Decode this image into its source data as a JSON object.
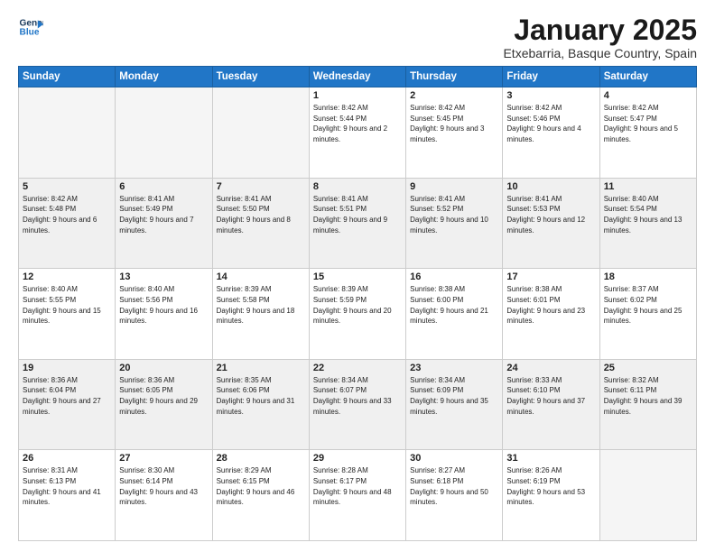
{
  "logo": {
    "line1": "General",
    "line2": "Blue"
  },
  "title": "January 2025",
  "subtitle": "Etxebarria, Basque Country, Spain",
  "headers": [
    "Sunday",
    "Monday",
    "Tuesday",
    "Wednesday",
    "Thursday",
    "Friday",
    "Saturday"
  ],
  "weeks": [
    [
      {
        "day": "",
        "sunrise": "",
        "sunset": "",
        "daylight": ""
      },
      {
        "day": "",
        "sunrise": "",
        "sunset": "",
        "daylight": ""
      },
      {
        "day": "",
        "sunrise": "",
        "sunset": "",
        "daylight": ""
      },
      {
        "day": "1",
        "sunrise": "Sunrise: 8:42 AM",
        "sunset": "Sunset: 5:44 PM",
        "daylight": "Daylight: 9 hours and 2 minutes."
      },
      {
        "day": "2",
        "sunrise": "Sunrise: 8:42 AM",
        "sunset": "Sunset: 5:45 PM",
        "daylight": "Daylight: 9 hours and 3 minutes."
      },
      {
        "day": "3",
        "sunrise": "Sunrise: 8:42 AM",
        "sunset": "Sunset: 5:46 PM",
        "daylight": "Daylight: 9 hours and 4 minutes."
      },
      {
        "day": "4",
        "sunrise": "Sunrise: 8:42 AM",
        "sunset": "Sunset: 5:47 PM",
        "daylight": "Daylight: 9 hours and 5 minutes."
      }
    ],
    [
      {
        "day": "5",
        "sunrise": "Sunrise: 8:42 AM",
        "sunset": "Sunset: 5:48 PM",
        "daylight": "Daylight: 9 hours and 6 minutes."
      },
      {
        "day": "6",
        "sunrise": "Sunrise: 8:41 AM",
        "sunset": "Sunset: 5:49 PM",
        "daylight": "Daylight: 9 hours and 7 minutes."
      },
      {
        "day": "7",
        "sunrise": "Sunrise: 8:41 AM",
        "sunset": "Sunset: 5:50 PM",
        "daylight": "Daylight: 9 hours and 8 minutes."
      },
      {
        "day": "8",
        "sunrise": "Sunrise: 8:41 AM",
        "sunset": "Sunset: 5:51 PM",
        "daylight": "Daylight: 9 hours and 9 minutes."
      },
      {
        "day": "9",
        "sunrise": "Sunrise: 8:41 AM",
        "sunset": "Sunset: 5:52 PM",
        "daylight": "Daylight: 9 hours and 10 minutes."
      },
      {
        "day": "10",
        "sunrise": "Sunrise: 8:41 AM",
        "sunset": "Sunset: 5:53 PM",
        "daylight": "Daylight: 9 hours and 12 minutes."
      },
      {
        "day": "11",
        "sunrise": "Sunrise: 8:40 AM",
        "sunset": "Sunset: 5:54 PM",
        "daylight": "Daylight: 9 hours and 13 minutes."
      }
    ],
    [
      {
        "day": "12",
        "sunrise": "Sunrise: 8:40 AM",
        "sunset": "Sunset: 5:55 PM",
        "daylight": "Daylight: 9 hours and 15 minutes."
      },
      {
        "day": "13",
        "sunrise": "Sunrise: 8:40 AM",
        "sunset": "Sunset: 5:56 PM",
        "daylight": "Daylight: 9 hours and 16 minutes."
      },
      {
        "day": "14",
        "sunrise": "Sunrise: 8:39 AM",
        "sunset": "Sunset: 5:58 PM",
        "daylight": "Daylight: 9 hours and 18 minutes."
      },
      {
        "day": "15",
        "sunrise": "Sunrise: 8:39 AM",
        "sunset": "Sunset: 5:59 PM",
        "daylight": "Daylight: 9 hours and 20 minutes."
      },
      {
        "day": "16",
        "sunrise": "Sunrise: 8:38 AM",
        "sunset": "Sunset: 6:00 PM",
        "daylight": "Daylight: 9 hours and 21 minutes."
      },
      {
        "day": "17",
        "sunrise": "Sunrise: 8:38 AM",
        "sunset": "Sunset: 6:01 PM",
        "daylight": "Daylight: 9 hours and 23 minutes."
      },
      {
        "day": "18",
        "sunrise": "Sunrise: 8:37 AM",
        "sunset": "Sunset: 6:02 PM",
        "daylight": "Daylight: 9 hours and 25 minutes."
      }
    ],
    [
      {
        "day": "19",
        "sunrise": "Sunrise: 8:36 AM",
        "sunset": "Sunset: 6:04 PM",
        "daylight": "Daylight: 9 hours and 27 minutes."
      },
      {
        "day": "20",
        "sunrise": "Sunrise: 8:36 AM",
        "sunset": "Sunset: 6:05 PM",
        "daylight": "Daylight: 9 hours and 29 minutes."
      },
      {
        "day": "21",
        "sunrise": "Sunrise: 8:35 AM",
        "sunset": "Sunset: 6:06 PM",
        "daylight": "Daylight: 9 hours and 31 minutes."
      },
      {
        "day": "22",
        "sunrise": "Sunrise: 8:34 AM",
        "sunset": "Sunset: 6:07 PM",
        "daylight": "Daylight: 9 hours and 33 minutes."
      },
      {
        "day": "23",
        "sunrise": "Sunrise: 8:34 AM",
        "sunset": "Sunset: 6:09 PM",
        "daylight": "Daylight: 9 hours and 35 minutes."
      },
      {
        "day": "24",
        "sunrise": "Sunrise: 8:33 AM",
        "sunset": "Sunset: 6:10 PM",
        "daylight": "Daylight: 9 hours and 37 minutes."
      },
      {
        "day": "25",
        "sunrise": "Sunrise: 8:32 AM",
        "sunset": "Sunset: 6:11 PM",
        "daylight": "Daylight: 9 hours and 39 minutes."
      }
    ],
    [
      {
        "day": "26",
        "sunrise": "Sunrise: 8:31 AM",
        "sunset": "Sunset: 6:13 PM",
        "daylight": "Daylight: 9 hours and 41 minutes."
      },
      {
        "day": "27",
        "sunrise": "Sunrise: 8:30 AM",
        "sunset": "Sunset: 6:14 PM",
        "daylight": "Daylight: 9 hours and 43 minutes."
      },
      {
        "day": "28",
        "sunrise": "Sunrise: 8:29 AM",
        "sunset": "Sunset: 6:15 PM",
        "daylight": "Daylight: 9 hours and 46 minutes."
      },
      {
        "day": "29",
        "sunrise": "Sunrise: 8:28 AM",
        "sunset": "Sunset: 6:17 PM",
        "daylight": "Daylight: 9 hours and 48 minutes."
      },
      {
        "day": "30",
        "sunrise": "Sunrise: 8:27 AM",
        "sunset": "Sunset: 6:18 PM",
        "daylight": "Daylight: 9 hours and 50 minutes."
      },
      {
        "day": "31",
        "sunrise": "Sunrise: 8:26 AM",
        "sunset": "Sunset: 6:19 PM",
        "daylight": "Daylight: 9 hours and 53 minutes."
      },
      {
        "day": "",
        "sunrise": "",
        "sunset": "",
        "daylight": ""
      }
    ]
  ]
}
